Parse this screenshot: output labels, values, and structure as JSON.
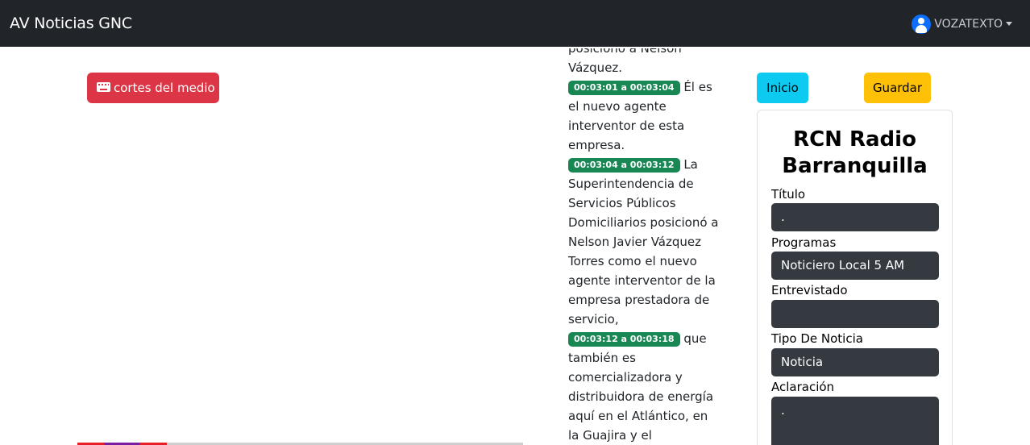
{
  "navbar": {
    "brand": "AV Noticias GNC",
    "user_name": "VOZATEXTO"
  },
  "media": {
    "cortes_button": "cortes del medio",
    "progress_fraction": 0.2
  },
  "transcript": {
    "top_clipped_text": "posicionó a Nelson",
    "intro_text": "Vázquez.",
    "segments": [
      {
        "time": "00:03:01 a 00:03:04",
        "text": "Él es el nuevo agente interventor de esta empresa."
      },
      {
        "time": "00:03:04 a 00:03:12",
        "text": "La Superintendencia de Servicios Públicos Domiciliarios posicionó a Nelson Javier Vázquez Torres como el nuevo agente interventor de la empresa prestadora de servicio,"
      },
      {
        "time": "00:03:12 a 00:03:18",
        "text": "que también es comercializadora y distribuidora de energía aquí en el Atlántico, en la Guajira y el Magdalena."
      }
    ]
  },
  "actions": {
    "inicio": "Inicio",
    "guardar": "Guardar"
  },
  "form": {
    "station": "RCN Radio Barranquilla",
    "titulo_label": "Título",
    "titulo_value": ".",
    "programas_label": "Programas",
    "programas_value": "Noticiero Local 5 AM",
    "entrevistado_label": "Entrevistado",
    "entrevistado_value": "",
    "tipo_label": "Tipo De Noticia",
    "tipo_value": "Noticia",
    "aclaracion_label": "Aclaración",
    "aclaracion_value": "."
  },
  "colors": {
    "navbar": "#212529",
    "danger": "#dc3545",
    "success": "#198754",
    "info": "#0dcaf0",
    "warning": "#ffc107",
    "field_bg": "#343a40"
  },
  "icons": [
    "user-avatar-icon",
    "keyboard-icon",
    "caret-down-icon"
  ]
}
